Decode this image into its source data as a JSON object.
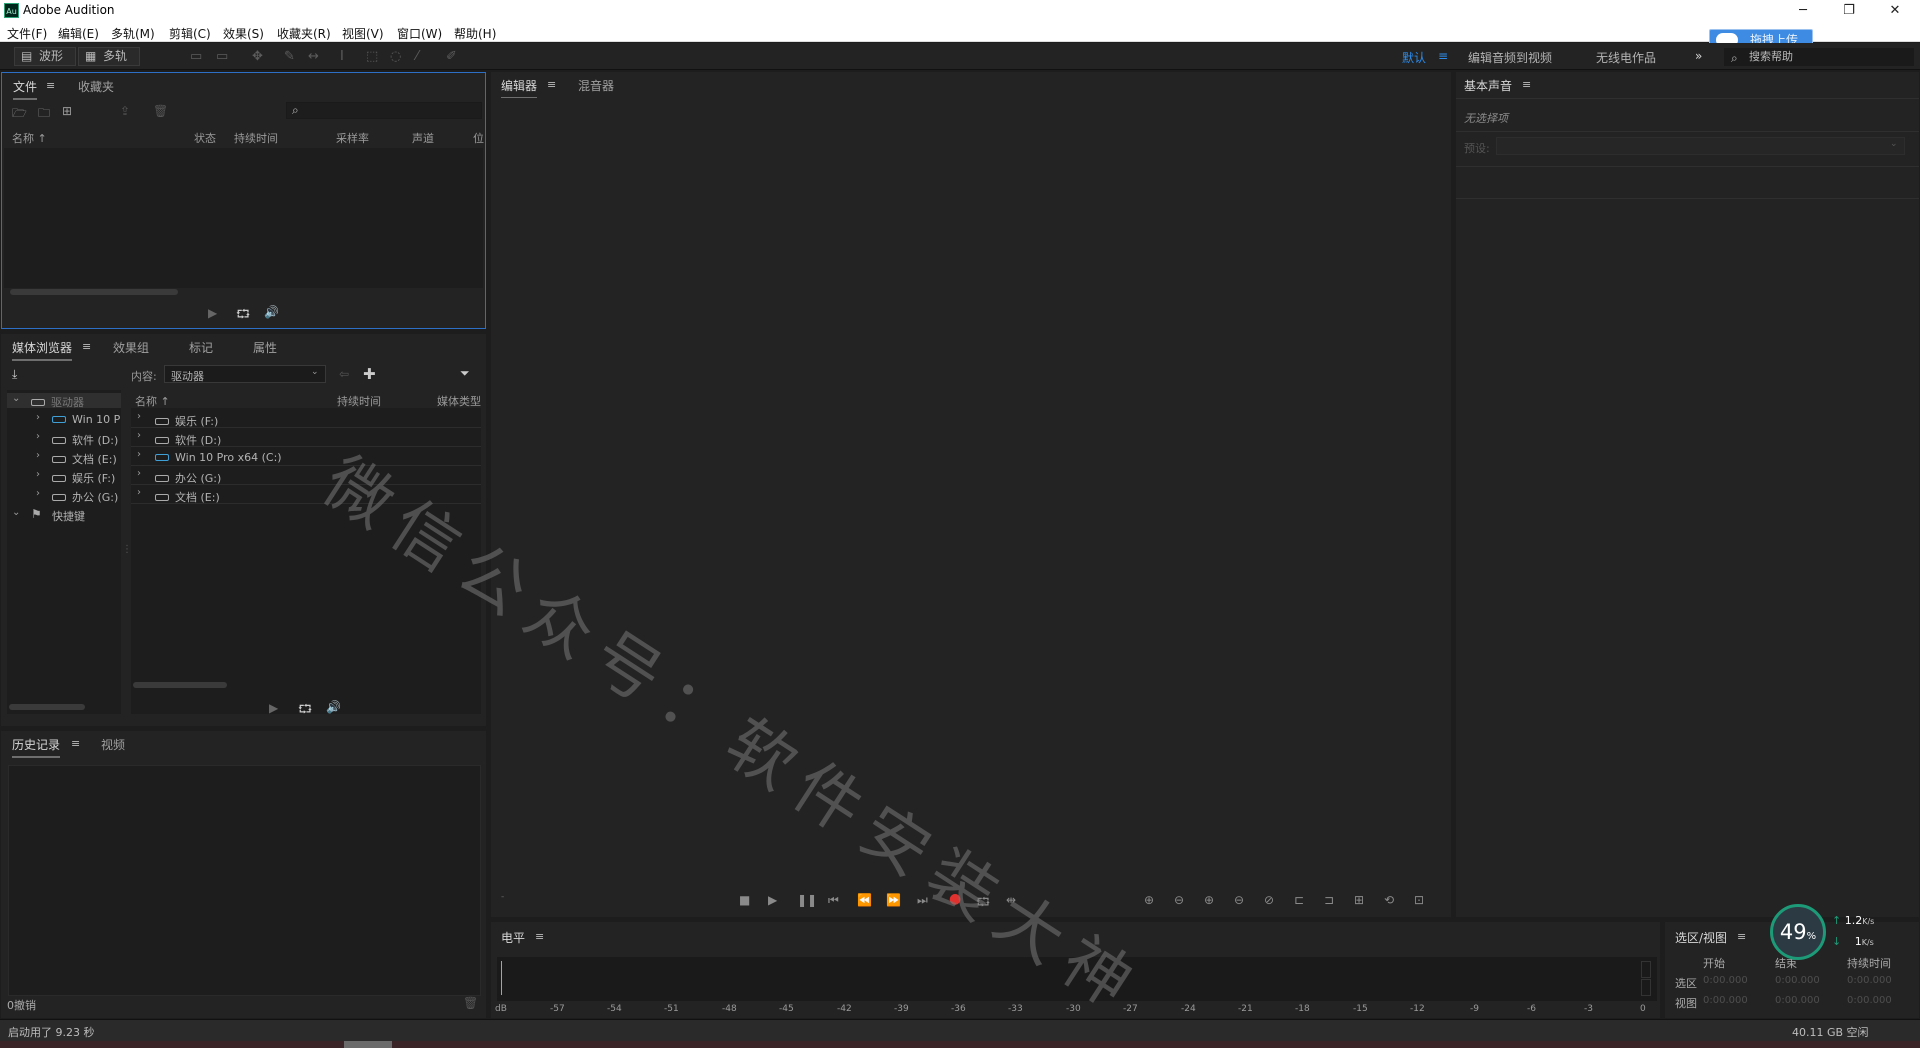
{
  "window": {
    "title": "Adobe Audition",
    "app_icon_text": "Au",
    "minimize": "─",
    "restore": "❐",
    "close": "✕"
  },
  "menu": [
    "文件(F)",
    "编辑(E)",
    "多轨(M)",
    "剪辑(C)",
    "效果(S)",
    "收藏夹(R)",
    "视图(V)",
    "窗口(W)",
    "帮助(H)"
  ],
  "toolbar": {
    "waveform_label": "波形",
    "multitrack_label": "多轨"
  },
  "workspaces": {
    "default": "默认",
    "edit_audio_to_video": "编辑音频到视频",
    "radio_works": "无线电作品",
    "more": "»",
    "search_placeholder": "搜索帮助"
  },
  "upload_widget": {
    "label": "拖拽上传"
  },
  "files_panel": {
    "tabs": [
      "文件",
      "收藏夹"
    ],
    "search_placeholder": "",
    "columns": [
      "名称",
      "状态",
      "持续时间",
      "采样率",
      "声道",
      "位"
    ]
  },
  "media_browser": {
    "tabs": [
      "媒体浏览器",
      "效果组",
      "标记",
      "属性"
    ],
    "content_label": "内容:",
    "content_value": "驱动器",
    "tree": [
      {
        "label": "驱动器",
        "expanded": true,
        "level": 0
      },
      {
        "label": "Win 10 P",
        "level": 1
      },
      {
        "label": "软件 (D:)",
        "level": 1
      },
      {
        "label": "文档 (E:)",
        "level": 1
      },
      {
        "label": "娱乐 (F:)",
        "level": 1
      },
      {
        "label": "办公 (G:)",
        "level": 1
      },
      {
        "label": "快捷键",
        "expanded": true,
        "level": 0
      }
    ],
    "columns": [
      "名称",
      "持续时间",
      "媒体类型"
    ],
    "rows": [
      "娱乐 (F:)",
      "软件 (D:)",
      "Win 10 Pro x64 (C:)",
      "办公 (G:)",
      "文档 (E:)"
    ]
  },
  "history_panel": {
    "tabs": [
      "历史记录",
      "视频"
    ],
    "undo_count": "0撤销"
  },
  "editor": {
    "tabs": [
      "编辑器",
      "混音器"
    ]
  },
  "essential_sound": {
    "title": "基本声音",
    "no_selection": "无选择项",
    "preset_label": "预设:"
  },
  "level_panel": {
    "title": "电平",
    "scale": [
      "dB",
      "-57",
      "-54",
      "-51",
      "-48",
      "-45",
      "-42",
      "-39",
      "-36",
      "-33",
      "-30",
      "-27",
      "-24",
      "-21",
      "-18",
      "-15",
      "-12",
      "-9",
      "-6",
      "-3",
      "0"
    ]
  },
  "selection_view": {
    "title": "选区/视图",
    "headers": [
      "开始",
      "结束",
      "持续时间"
    ],
    "rows": [
      {
        "label": "选区",
        "start": "0:00.000",
        "end": "0:00.000",
        "duration": "0:00.000"
      },
      {
        "label": "视图",
        "start": "0:00.000",
        "end": "0:00.000",
        "duration": "0:00.000"
      }
    ]
  },
  "speed_widget": {
    "percent": "49",
    "percent_sign": "%",
    "up": "1.2",
    "down": "1",
    "unit": "K/s"
  },
  "status": {
    "startup": "启动用了 9.23 秒",
    "disk_free": "40.11 GB 空闲"
  },
  "watermark": "微信公众号：软件安装大神",
  "colors": {
    "accent": "#2d8ceb",
    "record": "#e0312f",
    "panel_bg": "#232323",
    "focus_border": "#2d6ec7"
  }
}
